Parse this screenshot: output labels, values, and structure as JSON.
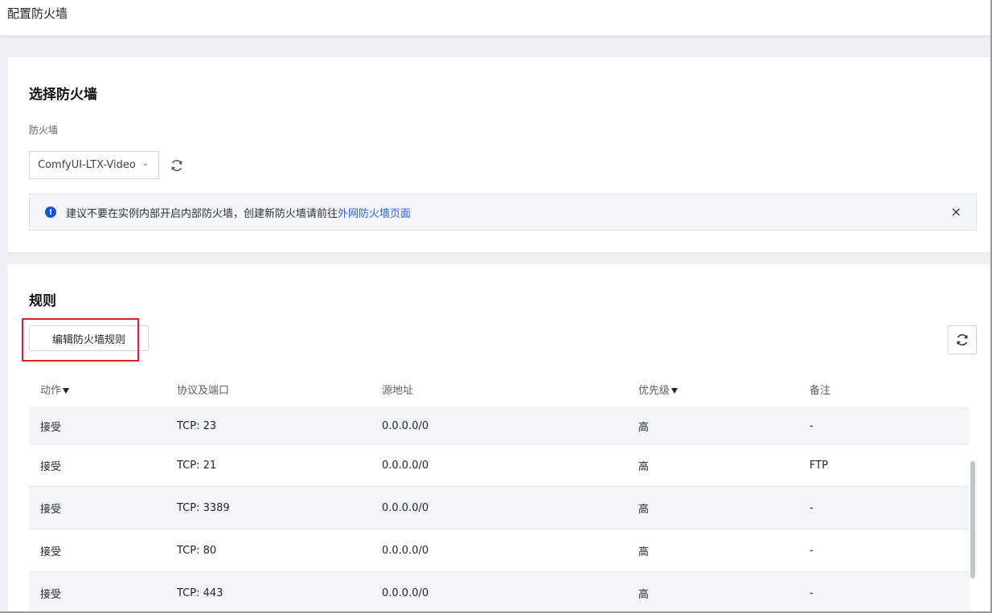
{
  "header": {
    "title": "配置防火墙"
  },
  "select_section": {
    "title": "选择防火墙",
    "field_label": "防火墙",
    "selected_value": "ComfyUI-LTX-Video",
    "notice": {
      "text": "建议不要在实例内部开启内部防火墙，创建新防火墙请前往",
      "link_text": "外网防火墙页面",
      "close": "×"
    }
  },
  "rules_section": {
    "title": "规则",
    "edit_button": "编辑防火墙规则",
    "columns": [
      "动作",
      "协议及端口",
      "源地址",
      "优先级",
      "备注"
    ],
    "rows": [
      [
        "接受",
        "TCP: 23",
        "0.0.0.0/0",
        "高",
        "-"
      ],
      [
        "接受",
        "TCP: 21",
        "0.0.0.0/0",
        "高",
        "FTP"
      ],
      [
        "接受",
        "TCP: 3389",
        "0.0.0.0/0",
        "高",
        "-"
      ],
      [
        "接受",
        "TCP: 80",
        "0.0.0.0/0",
        "高",
        "-"
      ],
      [
        "接受",
        "TCP: 443",
        "0.0.0.0/0",
        "高",
        "-"
      ]
    ]
  },
  "colors": {
    "accent_blue": "#2d62e0",
    "info_icon": "#1a4fd6",
    "highlight_red": "#e02020"
  },
  "icons": {
    "refresh": "refresh-icon",
    "info": "info-icon",
    "close": "close-icon",
    "chevron": "chevron-down-icon",
    "filter": "filter-icon"
  }
}
